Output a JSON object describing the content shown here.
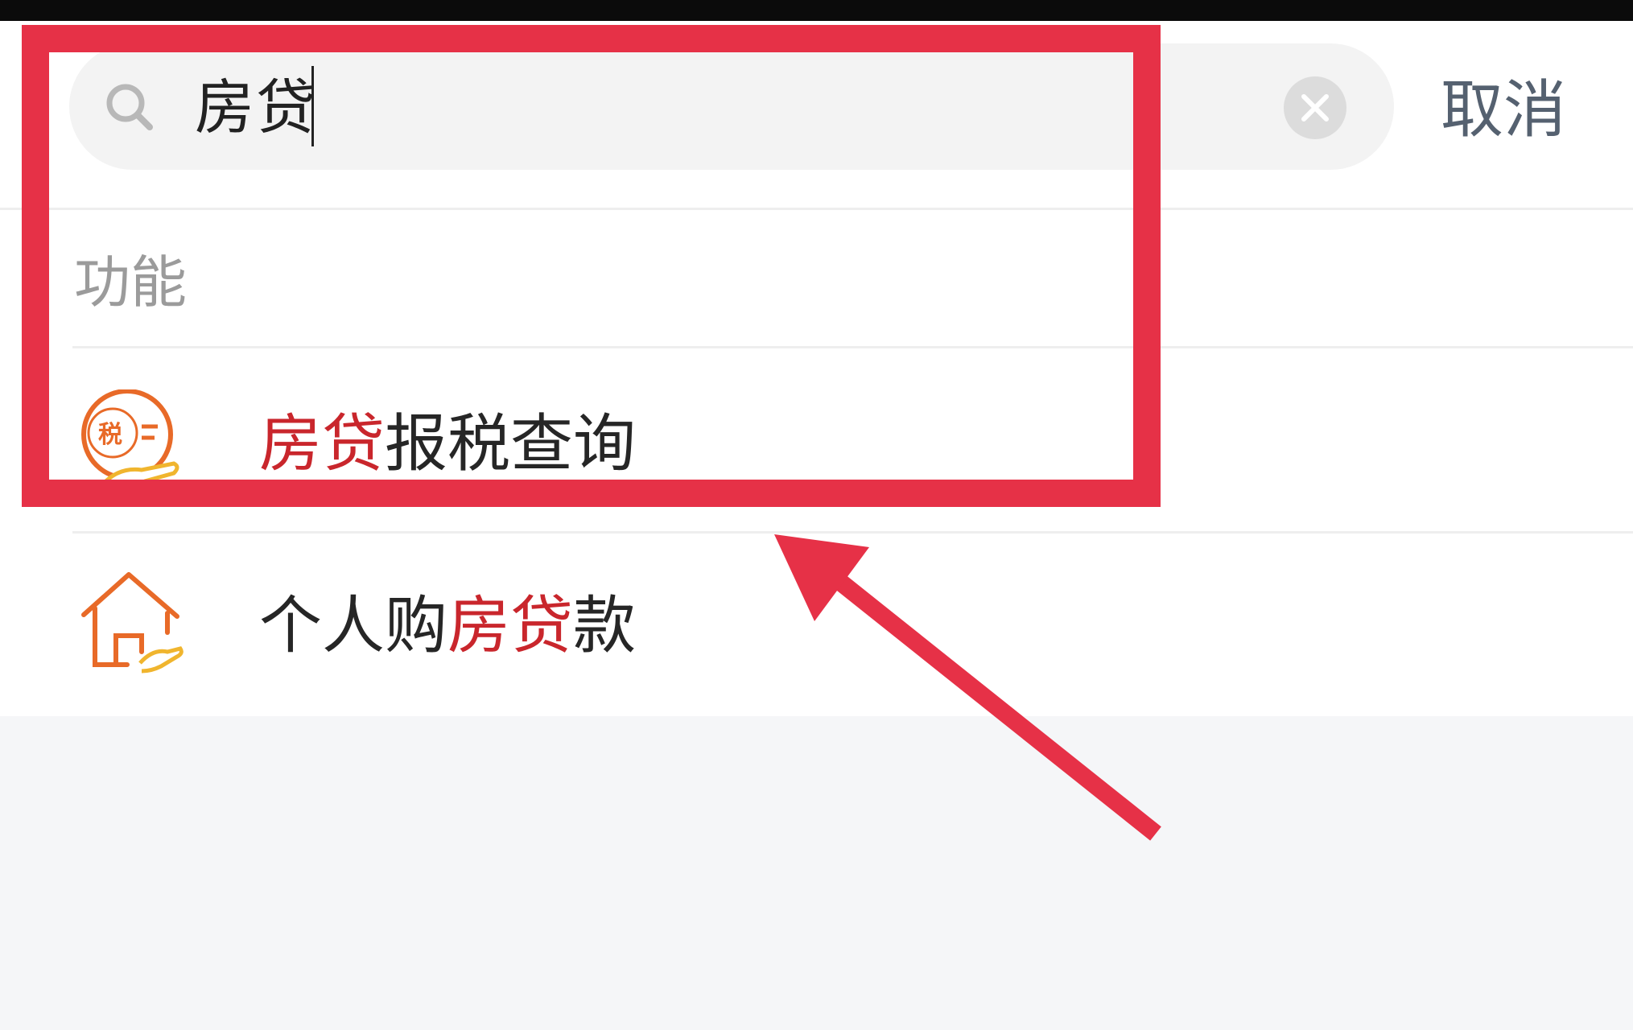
{
  "search": {
    "value": "房贷",
    "cancel_label": "取消"
  },
  "section": {
    "title": "功能"
  },
  "results": [
    {
      "highlight": "房贷",
      "text": "报税查询",
      "icon": "tax-hand-icon"
    },
    {
      "before": "个人购",
      "highlight": "房贷",
      "after": "款",
      "icon": "house-hand-icon"
    }
  ],
  "colors": {
    "highlight": "#c9262c",
    "annotation": "#e63147",
    "icon_orange": "#e86a28",
    "icon_yellow": "#f0b52e"
  },
  "icons": [
    "search-icon",
    "clear-icon",
    "tax-hand-icon",
    "house-hand-icon",
    "annotation-arrow"
  ]
}
